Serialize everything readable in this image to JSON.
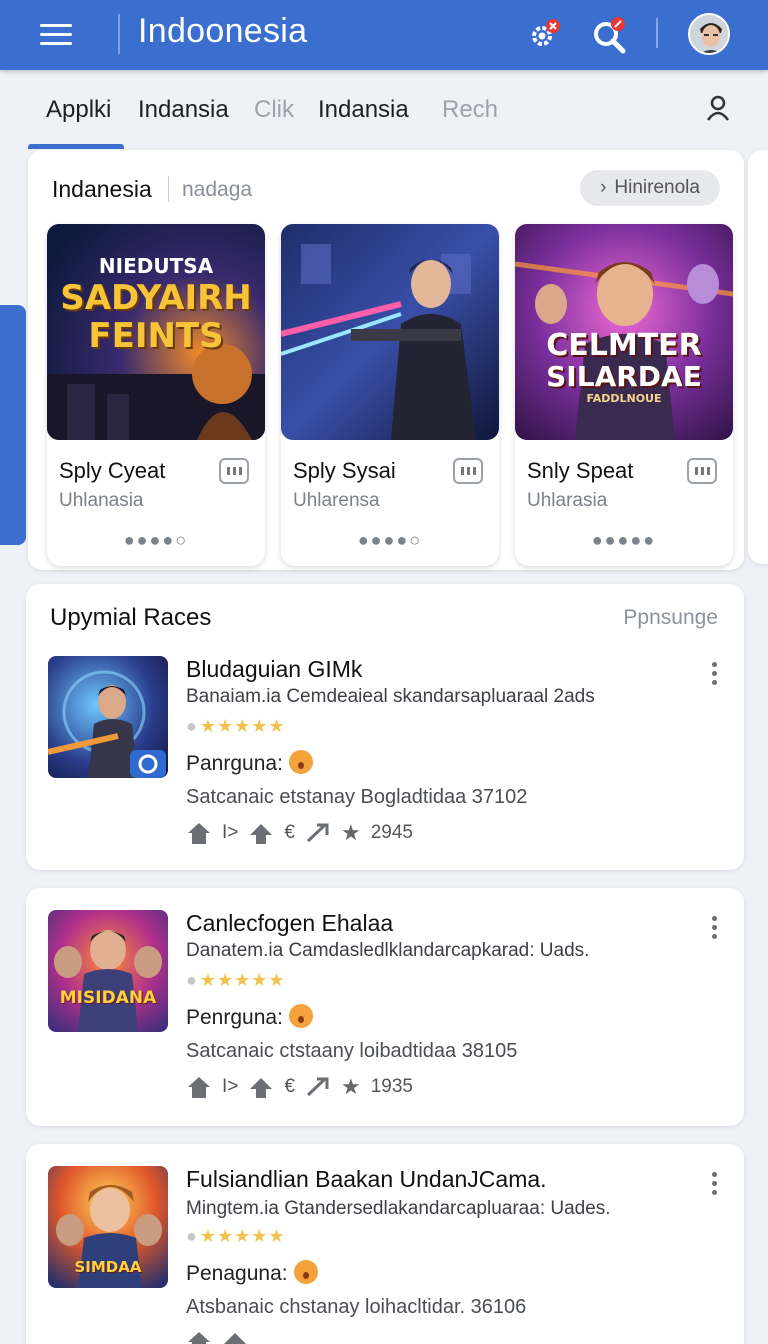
{
  "appbar": {
    "title": "Indoonesia"
  },
  "tabs": [
    {
      "label": "Applki"
    },
    {
      "label": "Indansia"
    },
    {
      "label": "Clik"
    },
    {
      "label": "Indansia"
    },
    {
      "label": "Rech"
    }
  ],
  "featured": {
    "title": "Indanesia",
    "subtitle": "nadaga",
    "chip_label": "Hinirenola",
    "cards": [
      {
        "thumb_line1": "NIEDUTSA",
        "thumb_line2": "SADYAIRH",
        "thumb_line3": "FEINTS",
        "name": "Sply Cyeat",
        "publisher": "Uhlanasia",
        "dots": "●●●●○"
      },
      {
        "name": "Sply Sysai",
        "publisher": "Uhlarensa",
        "dots": "●●●●○"
      },
      {
        "thumb_line1": "CELMTER",
        "thumb_line2": "SILARDAE",
        "thumb_line3": "FADDLNOUE",
        "name": "Snly Speat",
        "publisher": "Uhlarasia",
        "dots": "●●●●●"
      }
    ]
  },
  "list": {
    "title": "Upymial Races",
    "link": "Ppnsunge",
    "apps": [
      {
        "name": "Bludaguian GIMk",
        "desc": "Banaiam.ia Cemdeaieal skandarsapluaraal 2ads",
        "stars": "★★★★★",
        "user_label": "Panrguna:",
        "stat": "Satcanaic etstanay Bogladtidaa 37102",
        "rating_count": "2945"
      },
      {
        "name": "Canlecfogen Ehalaa",
        "desc": "Danatem.ia Camdasledlklandarcapkarad: Uads.",
        "stars": "★★★★★",
        "user_label": "Penrguna:",
        "stat": "Satcanaic ctstaany loibadtidaa 38105",
        "rating_count": "1935",
        "thumb_text": "MISIDANA"
      },
      {
        "name": "Fulsiandlian Baakan UndanJCama.",
        "desc": "Mingtem.ia Gtandersedlakandarcapluaraa: Uades.",
        "stars": "★★★★★",
        "user_label": "Penaguna:",
        "stat": "Atsbanaic chstanay loihacltidar. 36106",
        "thumb_text": "SIMDAA"
      }
    ]
  },
  "colors": {
    "primary": "#3a6fd0",
    "star": "#f2c24a"
  }
}
